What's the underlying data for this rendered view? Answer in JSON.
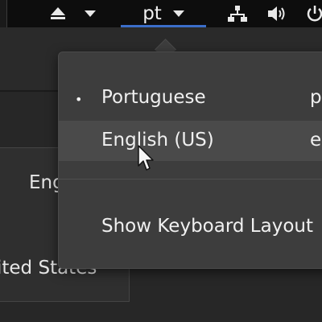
{
  "topbar": {
    "language_indicator": "pt",
    "icons": [
      "eject-icon",
      "chevron-down-icon",
      "chevron-down-icon",
      "network-icon",
      "volume-icon",
      "power-icon"
    ]
  },
  "background_window": {
    "label_top": "Eng",
    "label_bottom": "ited States"
  },
  "keyboard_menu": {
    "items": [
      {
        "label": "Portuguese",
        "code": "p",
        "active": true
      },
      {
        "label": "English (US)",
        "code": "er",
        "active": false,
        "hovered": true
      }
    ],
    "show_layout_label": "Show Keyboard Layout"
  },
  "colors": {
    "topbar_bg": "#0d0d0d",
    "menu_bg": "#3d3d3d",
    "menu_hover_bg": "#4a4a4a",
    "accent_underline": "#3b6ec9",
    "text": "#f0f0f0"
  }
}
